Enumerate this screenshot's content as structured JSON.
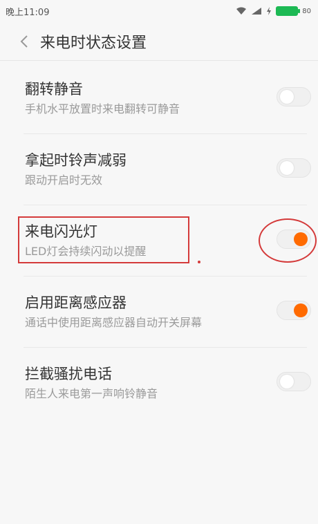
{
  "status_bar": {
    "time": "晚上11:09",
    "battery_label": "80"
  },
  "header": {
    "title": "来电时状态设置"
  },
  "settings": [
    {
      "title": "翻转静音",
      "subtitle": "手机水平放置时来电翻转可静音",
      "enabled": false
    },
    {
      "title": "拿起时铃声减弱",
      "subtitle": "跟动开启时无效",
      "enabled": false
    },
    {
      "title": "来电闪光灯",
      "subtitle": "LED灯会持续闪动以提醒",
      "enabled": true
    },
    {
      "title": "启用距离感应器",
      "subtitle": "通话中使用距离感应器自动开关屏幕",
      "enabled": true
    },
    {
      "title": "拦截骚扰电话",
      "subtitle": "陌生人来电第一声响铃静音",
      "enabled": false
    }
  ],
  "colors": {
    "accent": "#ff6a00",
    "annotation": "#d43a3a"
  }
}
